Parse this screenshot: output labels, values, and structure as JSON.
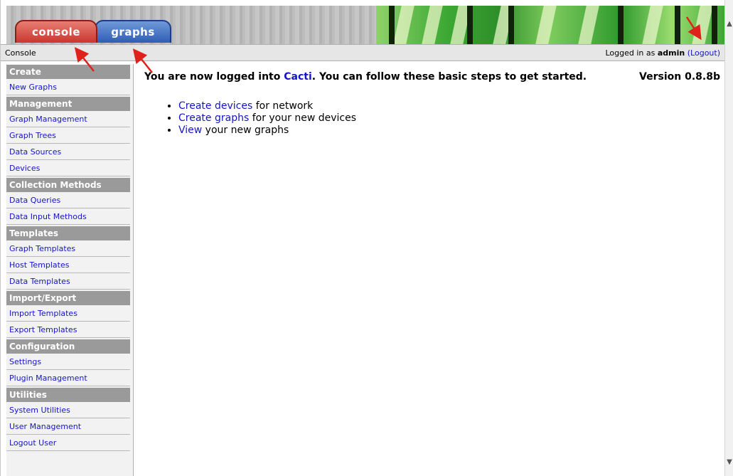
{
  "tabs": [
    {
      "label": "console"
    },
    {
      "label": "graphs"
    }
  ],
  "breadcrumb": "Console",
  "login": {
    "prefix": "Logged in as",
    "user": "admin",
    "logout_label": "(Logout)"
  },
  "sidebar": {
    "sections": [
      {
        "title": "Create",
        "items": [
          "New Graphs"
        ]
      },
      {
        "title": "Management",
        "items": [
          "Graph Management",
          "Graph Trees",
          "Data Sources",
          "Devices"
        ]
      },
      {
        "title": "Collection Methods",
        "items": [
          "Data Queries",
          "Data Input Methods"
        ]
      },
      {
        "title": "Templates",
        "items": [
          "Graph Templates",
          "Host Templates",
          "Data Templates"
        ]
      },
      {
        "title": "Import/Export",
        "items": [
          "Import Templates",
          "Export Templates"
        ]
      },
      {
        "title": "Configuration",
        "items": [
          "Settings",
          "Plugin Management"
        ]
      },
      {
        "title": "Utilities",
        "items": [
          "System Utilities",
          "User Management",
          "Logout User"
        ]
      }
    ]
  },
  "main": {
    "welcome_prefix": "You are now logged into ",
    "welcome_link": "Cacti",
    "welcome_suffix": ". You can follow these basic steps to get started.",
    "version": "Version 0.8.8b",
    "steps": [
      {
        "link": "Create devices",
        "text": " for network"
      },
      {
        "link": "Create graphs",
        "text": " for your new devices"
      },
      {
        "link": "View",
        "text": " your new graphs"
      }
    ]
  },
  "colors": {
    "link": "#1515c7",
    "menu_header": "#9a9a9a",
    "console_tab": "#c9372e",
    "graphs_tab": "#2f5db5",
    "annotation_arrow": "#e0201a"
  }
}
